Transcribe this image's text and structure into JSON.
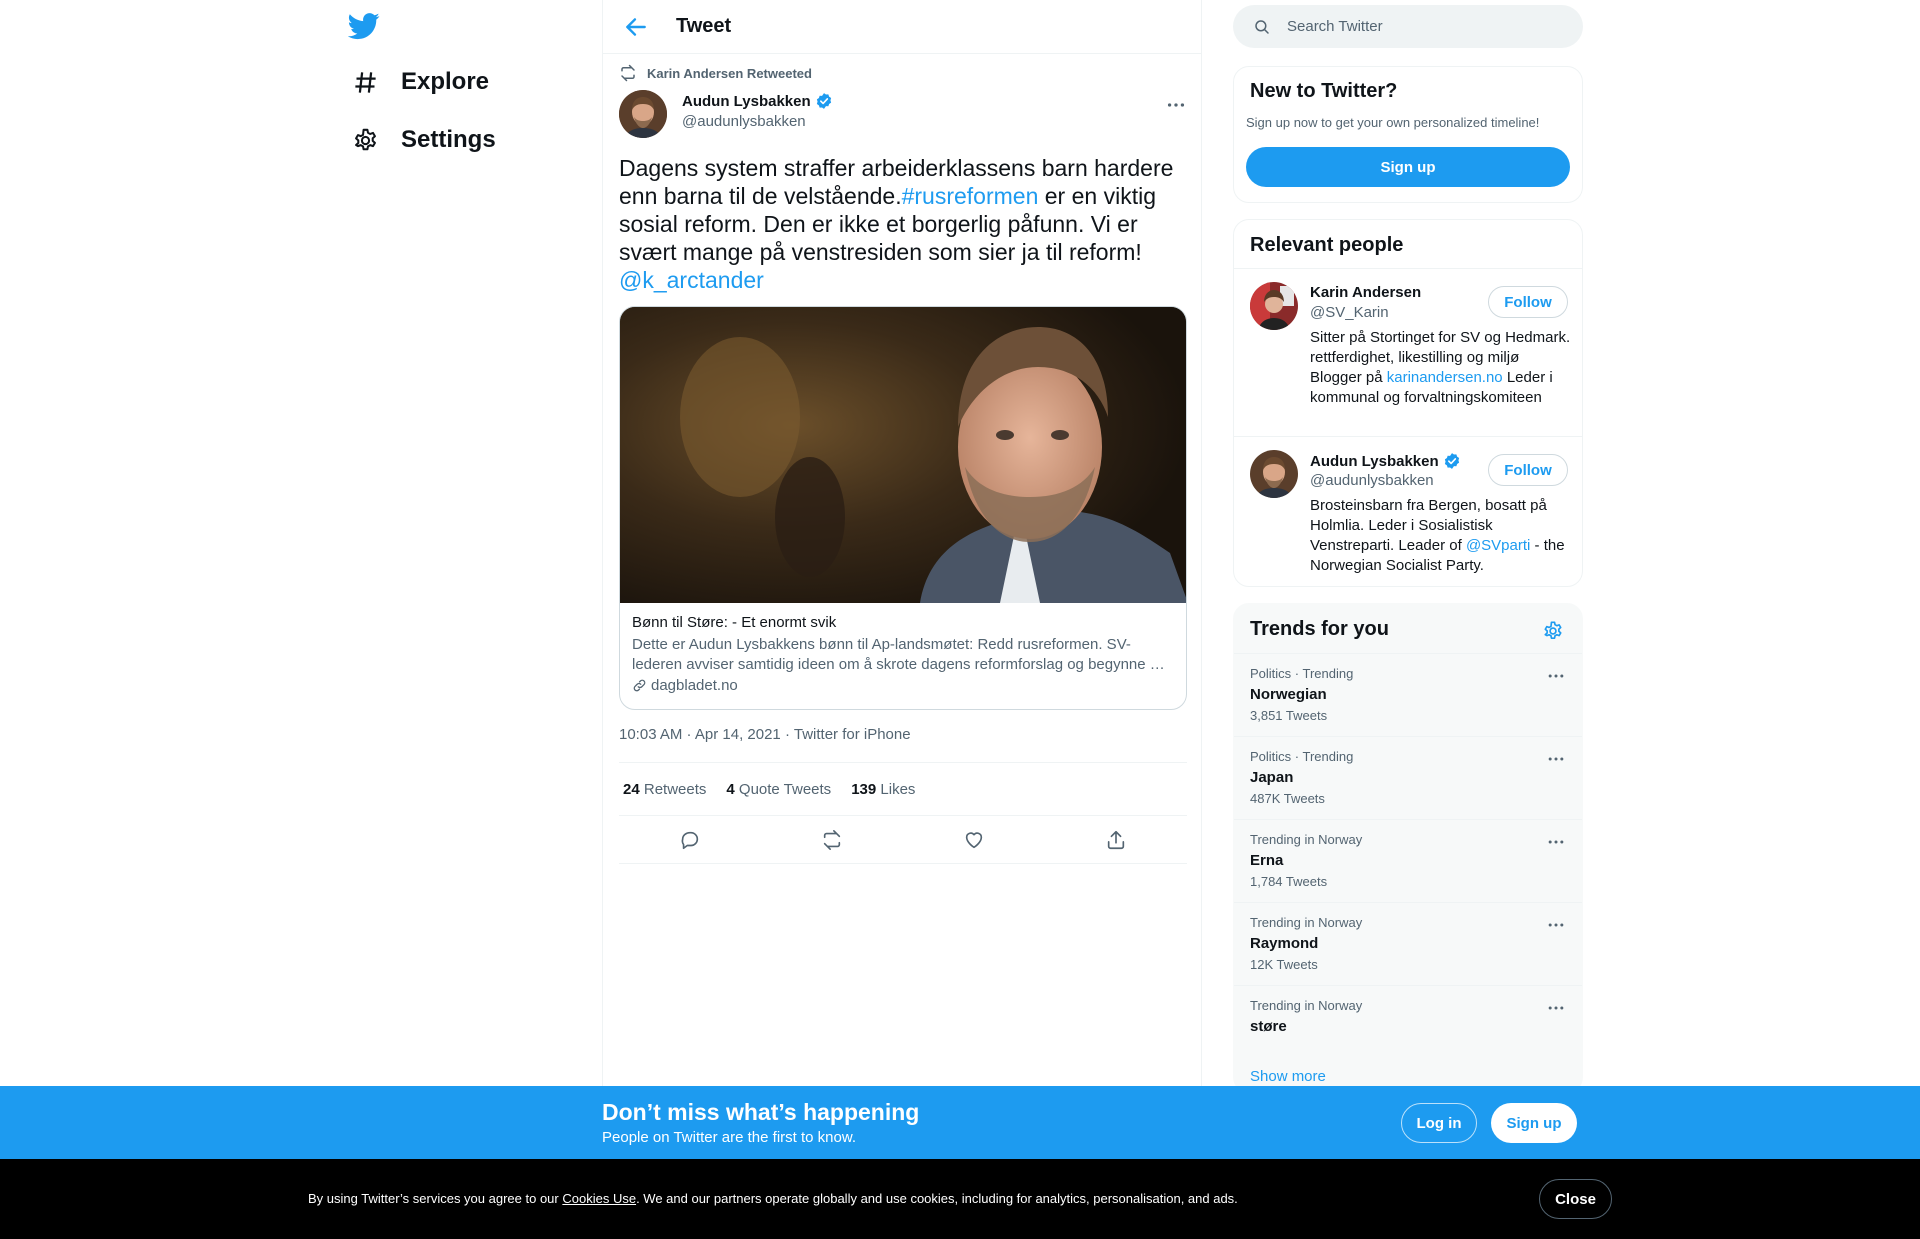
{
  "nav": {
    "logo_icon": "twitter-bird-icon",
    "items": [
      {
        "label": "Explore",
        "icon": "hashtag-icon"
      },
      {
        "label": "Settings",
        "icon": "gear-icon"
      }
    ]
  },
  "header": {
    "title": "Tweet",
    "back_icon": "arrow-left-icon"
  },
  "tweet": {
    "retweeted_by": "Karin Andersen Retweeted",
    "author_name": "Audun Lysbakken",
    "author_handle": "@audunlysbakken",
    "text_before_hashtag": "Dagens system straffer arbeiderklassens barn hardere enn barna til de velstående.",
    "hashtag": "#rusreformen",
    "text_after_hashtag": " er en viktig sosial reform. Den er ikke et borgerlig påfunn. Vi er svært mange på venstresiden som sier ja til reform!",
    "mention": "@k_arctander",
    "card": {
      "title": "Bønn til Støre: - Et enormt svik",
      "description": "Dette er Audun Lysbakkens bønn til Ap-landsmøtet: Redd rusreformen. SV-lederen avviser samtidig ideen om å skrote dagens reformforslag og begynne …",
      "domain": "dagbladet.no"
    },
    "timestamp": "10:03 AM · Apr 14, 2021",
    "source": "Twitter for iPhone",
    "stats": [
      {
        "count": "24",
        "label": "Retweets"
      },
      {
        "count": "4",
        "label": "Quote Tweets"
      },
      {
        "count": "139",
        "label": "Likes"
      }
    ]
  },
  "search": {
    "placeholder": "Search Twitter"
  },
  "new_to_twitter": {
    "title": "New to Twitter?",
    "subtitle": "Sign up now to get your own personalized timeline!",
    "button": "Sign up"
  },
  "relevant_people": {
    "title": "Relevant people",
    "people": [
      {
        "name": "Karin Andersen",
        "handle": "@SV_Karin",
        "verified": false,
        "follow": "Follow",
        "bio_before_link": "Sitter på Stortinget for SV og Hedmark. rettferdighet, likestilling og miljø Blogger på ",
        "bio_link": "karinandersen.no",
        "bio_after_link": " Leder i kommunal og forvaltningskomiteen"
      },
      {
        "name": "Audun Lysbakken",
        "handle": "@audunlysbakken",
        "verified": true,
        "follow": "Follow",
        "bio_before_link": "Brosteinsbarn fra Bergen, bosatt på Holmlia. Leder i Sosialistisk Venstreparti. Leader of ",
        "bio_link": "@SVparti",
        "bio_after_link": " - the Norwegian Socialist Party."
      }
    ]
  },
  "trends": {
    "title": "Trends for you",
    "items": [
      {
        "context": "Politics · Trending",
        "name": "Norwegian",
        "count": "3,851 Tweets"
      },
      {
        "context": "Politics · Trending",
        "name": "Japan",
        "count": "487K Tweets"
      },
      {
        "context": "Trending in Norway",
        "name": "Erna",
        "count": "1,784 Tweets"
      },
      {
        "context": "Trending in Norway",
        "name": "Raymond",
        "count": "12K Tweets"
      },
      {
        "context": "Trending in Norway",
        "name": "støre",
        "count": ""
      }
    ],
    "show_more": "Show more"
  },
  "banner": {
    "title": "Don’t miss what’s happening",
    "subtitle": "People on Twitter are the first to know.",
    "login": "Log in",
    "signup": "Sign up"
  },
  "cookie": {
    "text_before": "By using Twitter’s services you agree to our ",
    "link": "Cookies Use",
    "text_after": ". We and our partners operate globally and use cookies, including for analytics, personalisation, and ads.",
    "close": "Close"
  },
  "colors": {
    "accent": "#1d9bf0",
    "text": "#0f1419",
    "muted": "#536471"
  }
}
